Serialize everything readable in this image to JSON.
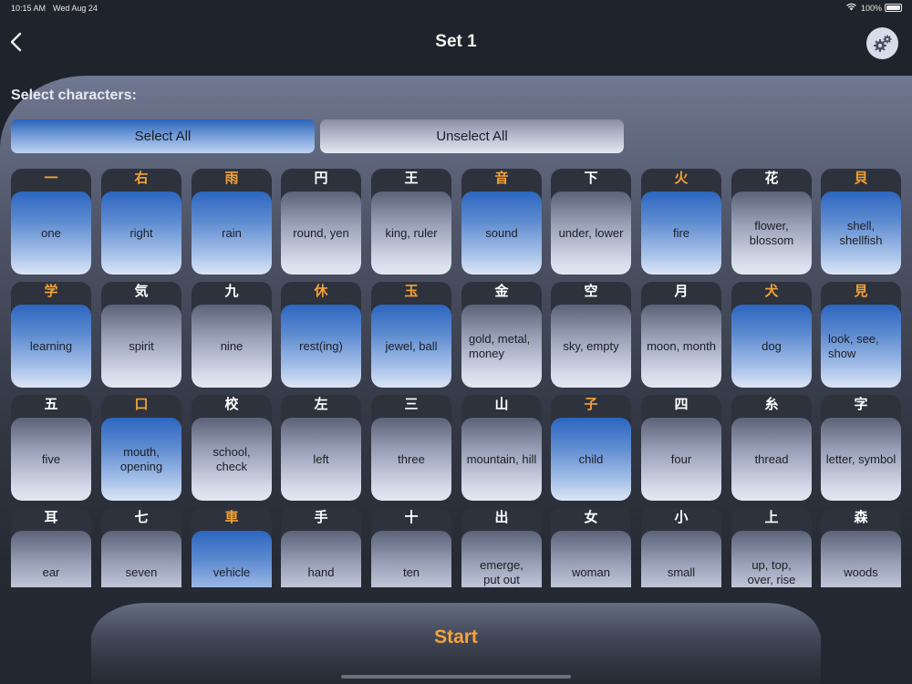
{
  "status_bar": {
    "time": "10:15 AM",
    "date": "Wed Aug 24",
    "wifi_icon": "wifi-icon",
    "battery": "100%"
  },
  "navbar": {
    "back_icon": "chevron-left-icon",
    "title": "Set 1",
    "settings_icon": "gears-icon"
  },
  "selection": {
    "label": "Select characters:",
    "select_all": "Select All",
    "unselect_all": "Unselect All"
  },
  "colors": {
    "accent_orange": "#f3a136",
    "selected_blue": "#2c66c0",
    "background": "#1f232b"
  },
  "characters": [
    {
      "kanji": "一",
      "meaning": "one",
      "selected": true
    },
    {
      "kanji": "右",
      "meaning": "right",
      "selected": true
    },
    {
      "kanji": "雨",
      "meaning": "rain",
      "selected": true
    },
    {
      "kanji": "円",
      "meaning": "round, yen",
      "selected": false
    },
    {
      "kanji": "王",
      "meaning": "king, ruler",
      "selected": false
    },
    {
      "kanji": "音",
      "meaning": "sound",
      "selected": true
    },
    {
      "kanji": "下",
      "meaning": "under, lower",
      "selected": false
    },
    {
      "kanji": "火",
      "meaning": "fire",
      "selected": true
    },
    {
      "kanji": "花",
      "meaning": "flower,\nblossom",
      "selected": false
    },
    {
      "kanji": "貝",
      "meaning": "shell,\nshellfish",
      "selected": true
    },
    {
      "kanji": "学",
      "meaning": "learning",
      "selected": true
    },
    {
      "kanji": "気",
      "meaning": "spirit",
      "selected": false
    },
    {
      "kanji": "九",
      "meaning": "nine",
      "selected": false
    },
    {
      "kanji": "休",
      "meaning": "rest(ing)",
      "selected": true
    },
    {
      "kanji": "玉",
      "meaning": "jewel, ball",
      "selected": true
    },
    {
      "kanji": "金",
      "meaning": "gold, metal,\nmoney",
      "selected": false,
      "left": true
    },
    {
      "kanji": "空",
      "meaning": "sky, empty",
      "selected": false
    },
    {
      "kanji": "月",
      "meaning": "moon, month",
      "selected": false
    },
    {
      "kanji": "犬",
      "meaning": "dog",
      "selected": true
    },
    {
      "kanji": "見",
      "meaning": "look, see,\nshow",
      "selected": true,
      "left": true
    },
    {
      "kanji": "五",
      "meaning": "five",
      "selected": false
    },
    {
      "kanji": "口",
      "meaning": "mouth,\nopening",
      "selected": true
    },
    {
      "kanji": "校",
      "meaning": "school, check",
      "selected": false
    },
    {
      "kanji": "左",
      "meaning": "left",
      "selected": false
    },
    {
      "kanji": "三",
      "meaning": "three",
      "selected": false
    },
    {
      "kanji": "山",
      "meaning": "mountain, hill",
      "selected": false
    },
    {
      "kanji": "子",
      "meaning": "child",
      "selected": true
    },
    {
      "kanji": "四",
      "meaning": "four",
      "selected": false
    },
    {
      "kanji": "糸",
      "meaning": "thread",
      "selected": false
    },
    {
      "kanji": "字",
      "meaning": "letter, symbol",
      "selected": false
    },
    {
      "kanji": "耳",
      "meaning": "ear",
      "selected": false
    },
    {
      "kanji": "七",
      "meaning": "seven",
      "selected": false
    },
    {
      "kanji": "車",
      "meaning": "vehicle",
      "selected": true
    },
    {
      "kanji": "手",
      "meaning": "hand",
      "selected": false
    },
    {
      "kanji": "十",
      "meaning": "ten",
      "selected": false
    },
    {
      "kanji": "出",
      "meaning": "emerge,\nput out",
      "selected": false
    },
    {
      "kanji": "女",
      "meaning": "woman",
      "selected": false
    },
    {
      "kanji": "小",
      "meaning": "small",
      "selected": false
    },
    {
      "kanji": "上",
      "meaning": "up, top,\nover, rise",
      "selected": false
    },
    {
      "kanji": "森",
      "meaning": "woods",
      "selected": false
    }
  ],
  "start": {
    "label": "Start"
  }
}
